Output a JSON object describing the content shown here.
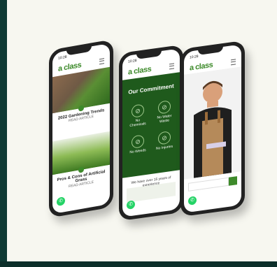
{
  "phones": [
    {
      "status_time": "10:28",
      "logo": "a class",
      "cards": [
        {
          "title": "2022 Gardening Trends",
          "meta": "READ ARTICLE"
        },
        {
          "title": "Pros & Cons of Artificial Grass",
          "meta": "READ ARTICLE"
        }
      ],
      "whatsapp_badge": "1"
    },
    {
      "status_time": "10:28",
      "logo": "a class",
      "heading": "Our Commitment",
      "items": [
        {
          "label": "No Chemicals",
          "icon": "no-chemicals-icon"
        },
        {
          "label": "No Water Waste",
          "icon": "no-water-waste-icon"
        },
        {
          "label": "No Weeds",
          "icon": "no-weeds-icon"
        },
        {
          "label": "No Injuries",
          "icon": "no-injuries-icon"
        }
      ],
      "promo": "We have over 15 years of experience",
      "whatsapp_badge": "1"
    },
    {
      "status_time": "10:28",
      "logo": "a class",
      "whatsapp_badge": "1"
    }
  ]
}
